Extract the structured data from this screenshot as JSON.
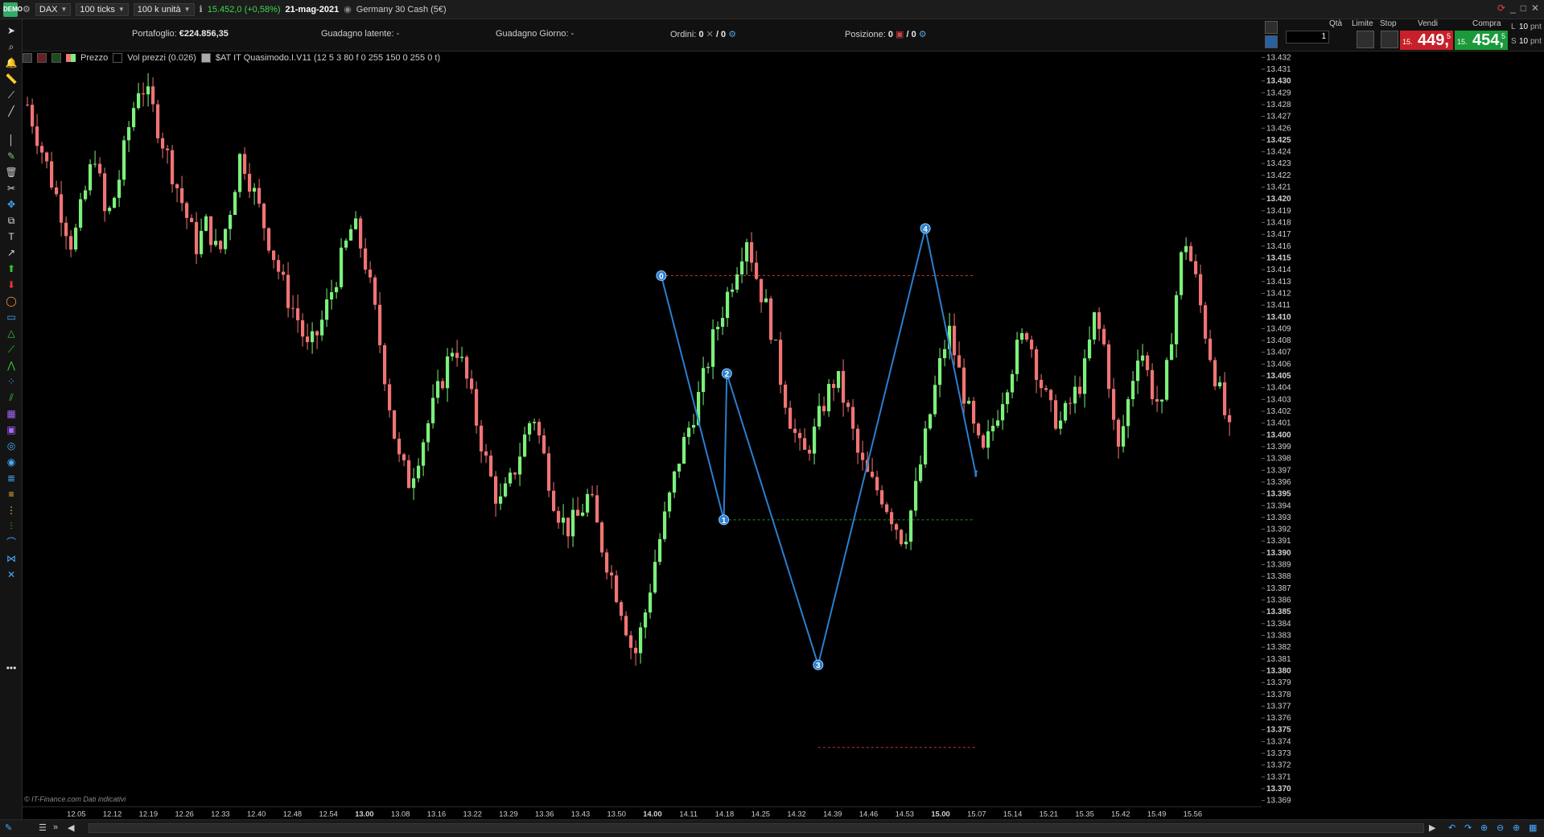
{
  "topbar": {
    "logo": "DEMO",
    "instrument": "DAX",
    "timeframe": "100 ticks",
    "units": "100 k unità",
    "last_price": "15.452,0 (+0,58%)",
    "date": "21-mag-2021",
    "market_name": "Germany 30 Cash (5€)"
  },
  "infobar": {
    "portfolio_label": "Portafoglio:",
    "portfolio_value": "€224.856,35",
    "latent_label": "Guadagno latente:",
    "latent_value": "-",
    "day_label": "Guadagno Giorno:",
    "day_value": "-",
    "orders_label": "Ordini:",
    "orders_value": "0",
    "orders_value2": "/ 0",
    "position_label": "Posizione:",
    "position_value": "0",
    "position_value2": "/ 0"
  },
  "trade_panel": {
    "qty_label": "Qtà",
    "qty_value": "1",
    "limit_label": "Limite",
    "stop_label": "Stop",
    "sell_label": "Vendi",
    "buy_label": "Compra",
    "sell_prefix": "15.",
    "sell_big": "449,",
    "sell_sup": "5",
    "buy_prefix": "15.",
    "buy_big": "454,",
    "buy_sup": "5",
    "l_label": "L",
    "s_label": "S",
    "l_value": "10",
    "s_value": "10",
    "pnt1": "pnt",
    "pnt2": "pnt",
    "buy_color": "#1a9a3a",
    "sell_color": "#c8202a"
  },
  "legend": {
    "price": "Prezzo",
    "volume": "Vol prezzi (0.026)",
    "indicator": "$AT IT Quasimodo.I.V11 (12 5 3 80 f 0 255 150 0 255 0 t)"
  },
  "watermark": "© IT-Finance.com  Dati indicativi",
  "price_axis_labels": [
    "13.432",
    "13.431",
    "13.430",
    "13.429",
    "13.428",
    "13.427",
    "13.426",
    "13.425",
    "13.424",
    "13.423",
    "13.422",
    "13.421",
    "13.420",
    "13.419",
    "13.418",
    "13.417",
    "13.416",
    "13.415",
    "13.414",
    "13.413",
    "13.412",
    "13.411",
    "13.410",
    "13.409",
    "13.408",
    "13.407",
    "13.406",
    "13.405",
    "13.404",
    "13.403",
    "13.402",
    "13.401",
    "13.400",
    "13.399",
    "13.398",
    "13.397",
    "13.396",
    "13.395",
    "13.394",
    "13.393",
    "13.392",
    "13.391",
    "13.390",
    "13.389",
    "13.388",
    "13.387",
    "13.386",
    "13.385",
    "13.384",
    "13.383",
    "13.382",
    "13.381",
    "13.380",
    "13.379",
    "13.378",
    "13.377",
    "13.376",
    "13.375",
    "13.374",
    "13.373",
    "13.372",
    "13.371",
    "13.370",
    "13.369"
  ],
  "time_axis_labels": [
    {
      "t": "12.05",
      "bold": false
    },
    {
      "t": "12.12",
      "bold": false
    },
    {
      "t": "12.19",
      "bold": false
    },
    {
      "t": "12.26",
      "bold": false
    },
    {
      "t": "12.33",
      "bold": false
    },
    {
      "t": "12.40",
      "bold": false
    },
    {
      "t": "12.48",
      "bold": false
    },
    {
      "t": "12.54",
      "bold": false
    },
    {
      "t": "13.00",
      "bold": true
    },
    {
      "t": "13.08",
      "bold": false
    },
    {
      "t": "13.16",
      "bold": false
    },
    {
      "t": "13.22",
      "bold": false
    },
    {
      "t": "13.29",
      "bold": false
    },
    {
      "t": "13.36",
      "bold": false
    },
    {
      "t": "13.43",
      "bold": false
    },
    {
      "t": "13.50",
      "bold": false
    },
    {
      "t": "14.00",
      "bold": true
    },
    {
      "t": "14.11",
      "bold": false
    },
    {
      "t": "14.18",
      "bold": false
    },
    {
      "t": "14.25",
      "bold": false
    },
    {
      "t": "14.32",
      "bold": false
    },
    {
      "t": "14.39",
      "bold": false
    },
    {
      "t": "14.46",
      "bold": false
    },
    {
      "t": "14.53",
      "bold": false
    },
    {
      "t": "15.00",
      "bold": true
    },
    {
      "t": "15.07",
      "bold": false
    },
    {
      "t": "15.14",
      "bold": false
    },
    {
      "t": "15.21",
      "bold": false
    },
    {
      "t": "15.35",
      "bold": false
    },
    {
      "t": "15.42",
      "bold": false
    },
    {
      "t": "15.49",
      "bold": false
    },
    {
      "t": "15.56",
      "bold": false
    }
  ],
  "chart_data": {
    "type": "candlestick",
    "price_min": 13.3685,
    "price_max": 13.4325,
    "candle_up_color": "#7cf07c",
    "candle_down_color": "#f07474",
    "close_path": [
      13.428,
      13.425,
      13.422,
      13.419,
      13.416,
      13.42,
      13.424,
      13.418,
      13.421,
      13.426,
      13.43,
      13.428,
      13.425,
      13.422,
      13.419,
      13.416,
      13.418,
      13.415,
      13.419,
      13.424,
      13.421,
      13.418,
      13.415,
      13.412,
      13.41,
      13.407,
      13.409,
      13.412,
      13.415,
      13.418,
      13.415,
      13.41,
      13.404,
      13.398,
      13.396,
      13.399,
      13.402,
      13.405,
      13.408,
      13.405,
      13.401,
      13.397,
      13.394,
      13.396,
      13.399,
      13.402,
      13.398,
      13.394,
      13.392,
      13.393,
      13.395,
      13.391,
      13.388,
      13.385,
      13.381,
      13.385,
      13.39,
      13.394,
      13.398,
      13.401,
      13.404,
      13.408,
      13.411,
      13.414,
      13.417,
      13.413,
      13.41,
      13.405,
      13.401,
      13.398,
      13.4,
      13.403,
      13.405,
      13.402,
      13.398,
      13.396,
      13.395,
      13.393,
      13.391,
      13.395,
      13.4,
      13.405,
      13.409,
      13.405,
      13.401,
      13.398,
      13.401,
      13.404,
      13.407,
      13.409,
      13.405,
      13.402,
      13.401,
      13.403,
      13.405,
      13.41,
      13.407,
      13.398,
      13.403,
      13.408,
      13.404,
      13.402,
      13.41,
      13.417,
      13.413,
      13.408,
      13.404,
      13.4
    ],
    "quasimodo_points": [
      {
        "label": "0",
        "price": 13.4135
      },
      {
        "label": "1",
        "price": 13.3928
      },
      {
        "label": "2",
        "price": 13.4052
      },
      {
        "label": "3",
        "price": 13.3805
      },
      {
        "label": "4",
        "price": 13.4175
      }
    ],
    "dashed_levels": [
      {
        "price": 13.4135,
        "color": "#c83232"
      },
      {
        "price": 13.3928,
        "color": "#2f8a2f"
      },
      {
        "price": 13.3735,
        "color": "#c83232"
      }
    ],
    "pattern_line_color": "#2a7fcf"
  }
}
